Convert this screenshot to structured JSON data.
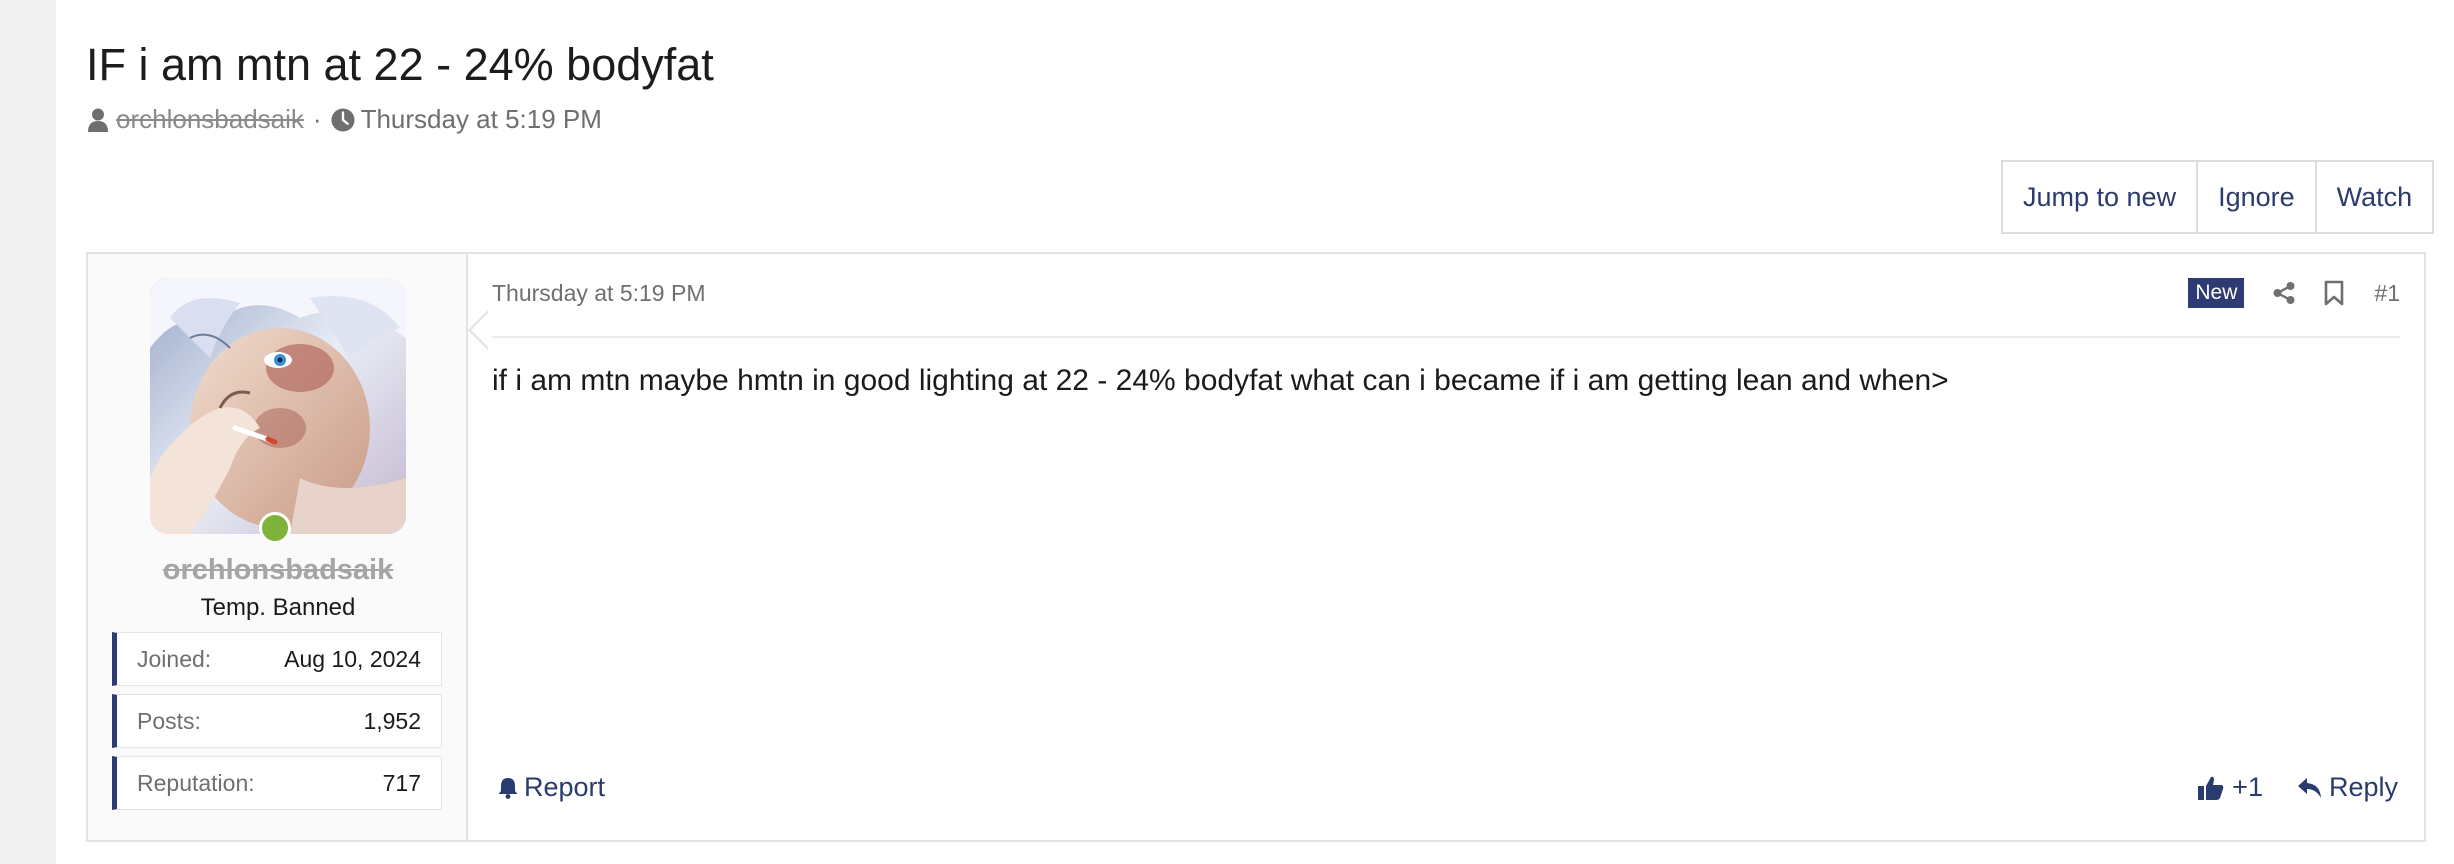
{
  "thread": {
    "title": "IF i am mtn at 22 - 24% bodyfat",
    "author": "orchlonsbadsaik",
    "separator": "·",
    "date": "Thursday at 5:19 PM"
  },
  "buttons": {
    "jump_to_new": "Jump to new",
    "ignore": "Ignore",
    "watch": "Watch"
  },
  "user": {
    "name": "orchlonsbadsaik",
    "title": "Temp. Banned",
    "online_color": "#7db33a",
    "stats": [
      {
        "label": "Joined:",
        "value": "Aug 10, 2024"
      },
      {
        "label": "Posts:",
        "value": "1,952"
      },
      {
        "label": "Reputation:",
        "value": "717"
      }
    ]
  },
  "post": {
    "date": "Thursday at 5:19 PM",
    "badge": "New",
    "number": "#1",
    "body": "if i am mtn maybe hmtn in good lighting at 22 - 24% bodyfat what can i became if i am getting lean and when>",
    "report_label": "Report",
    "like_label": "+1",
    "reply_label": "Reply"
  },
  "colors": {
    "accent": "#2e3a72",
    "link": "#2a3b6d",
    "muted": "#6f6f6f"
  },
  "icons": {
    "author": "user-icon",
    "date": "clock-icon",
    "share": "share-icon",
    "bookmark": "bookmark-icon",
    "report": "bell-icon",
    "like": "thumbs-up-icon",
    "reply": "reply-icon"
  }
}
